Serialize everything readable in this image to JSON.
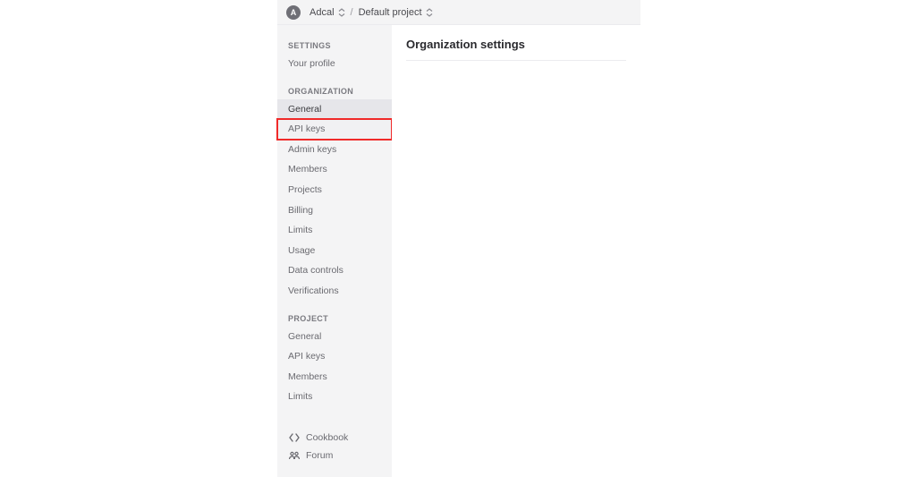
{
  "header": {
    "avatar_letter": "A",
    "org_name": "Adcal",
    "project_name": "Default project",
    "separator": "/"
  },
  "sidebar": {
    "settings_label": "SETTINGS",
    "your_profile": "Your profile",
    "organization_label": "ORGANIZATION",
    "org_items": [
      "General",
      "API keys",
      "Admin keys",
      "Members",
      "Projects",
      "Billing",
      "Limits",
      "Usage",
      "Data controls",
      "Verifications"
    ],
    "project_label": "PROJECT",
    "project_items": [
      "General",
      "API keys",
      "Members",
      "Limits"
    ],
    "footer": {
      "cookbook": "Cookbook",
      "forum": "Forum"
    }
  },
  "main": {
    "title": "Organization settings"
  }
}
